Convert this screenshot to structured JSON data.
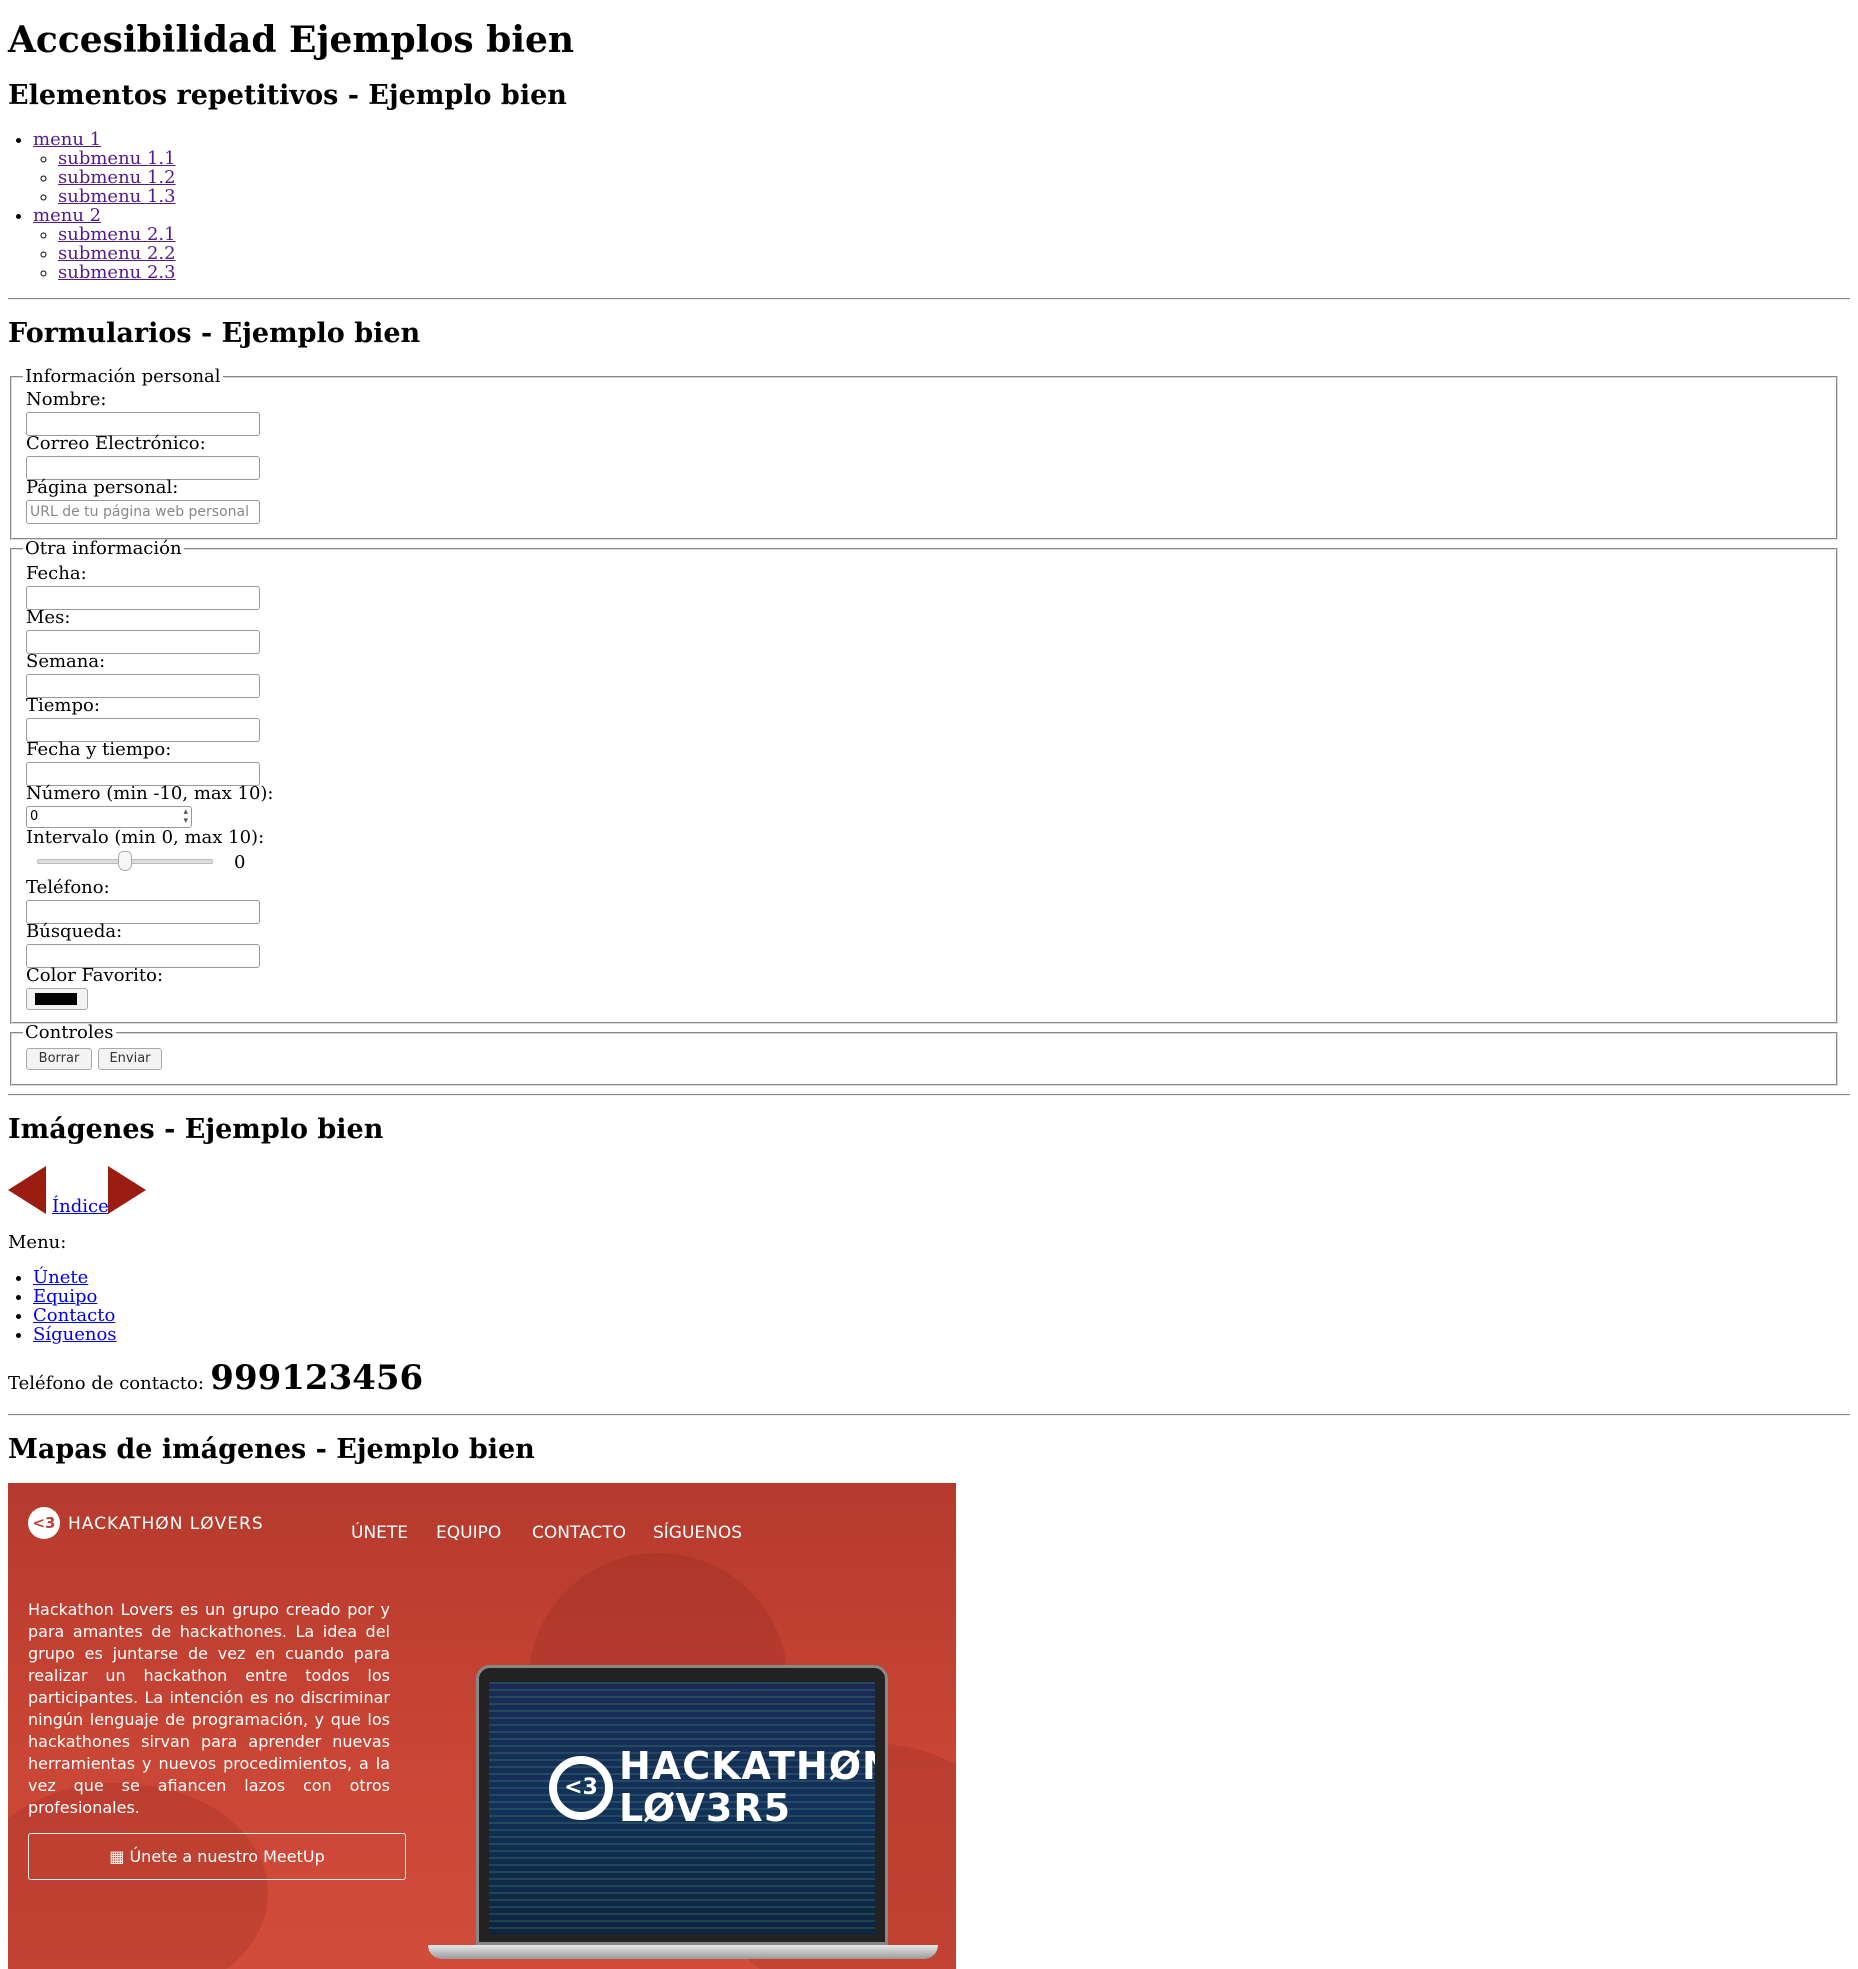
{
  "page_title": "Accesibilidad Ejemplos bien",
  "sections": {
    "repetitive": {
      "heading": "Elementos repetitivos - Ejemplo bien",
      "menus": [
        {
          "label": "menu 1",
          "items": [
            "submenu 1.1",
            "submenu 1.2",
            "submenu 1.3"
          ]
        },
        {
          "label": "menu 2",
          "items": [
            "submenu 2.1",
            "submenu 2.2",
            "submenu 2.3"
          ]
        }
      ]
    },
    "forms": {
      "heading": "Formularios - Ejemplo bien",
      "personal": {
        "legend": "Información personal",
        "nombre_label": "Nombre:",
        "nombre_value": "",
        "correo_label": "Correo Electrónico:",
        "correo_value": "",
        "pagina_label": "Página personal:",
        "pagina_placeholder": "URL de tu página web personal"
      },
      "other": {
        "legend": "Otra información",
        "fecha_label": "Fecha:",
        "mes_label": "Mes:",
        "semana_label": "Semana:",
        "tiempo_label": "Tiempo:",
        "fecha_tiempo_label": "Fecha y tiempo:",
        "numero_label": "Número (min -10, max 10):",
        "numero_value": "0",
        "intervalo_label": "Intervalo (min 0, max 10):",
        "intervalo_value": "0",
        "intervalo_slider_fraction": 0.5,
        "telefono_label": "Teléfono:",
        "busqueda_label": "Búsqueda:",
        "color_label": "Color Favorito:",
        "color_value": "#000000"
      },
      "controls": {
        "legend": "Controles",
        "reset_label": "Borrar",
        "submit_label": "Enviar"
      }
    },
    "images": {
      "heading": "Imágenes - Ejemplo bien",
      "prev_icon": "arrow-left-icon",
      "next_icon": "arrow-right-icon",
      "arrow_color": "#9b1c10",
      "index_link": "Índice",
      "menu_label": "Menu:",
      "menu_items": [
        "Únete",
        "Equipo",
        "Contacto",
        "Síguenos"
      ],
      "phone_label": "Teléfono de contacto:",
      "phone_number": "999123456"
    },
    "image_maps": {
      "heading": "Mapas de imágenes - Ejemplo bien",
      "brand_text": "HACKATHØN LØVERS",
      "logo_glyph": "<3",
      "nav": [
        "ÚNETE",
        "EQUIPO",
        "CONTACTO",
        "SÍGUENOS"
      ],
      "description": "Hackathon Lovers es un grupo creado por y para amantes de hackathones. La idea del grupo es juntarse de vez en cuando para realizar un hackathon entre todos los participantes. La intención es no discriminar ningún lenguaje de programación, y que los hackathones sirvan para aprender nuevas herramientas y nuevos procedimientos, a la vez que se afiancen lazos con otros profesionales.",
      "meetup_button": "Únete a nuestro MeetUp",
      "meetup_icon": "calendar-icon",
      "screen_title_1": "HACKATHØN",
      "screen_title_2": "LØV3R5",
      "background_color": "#c0432f"
    }
  }
}
